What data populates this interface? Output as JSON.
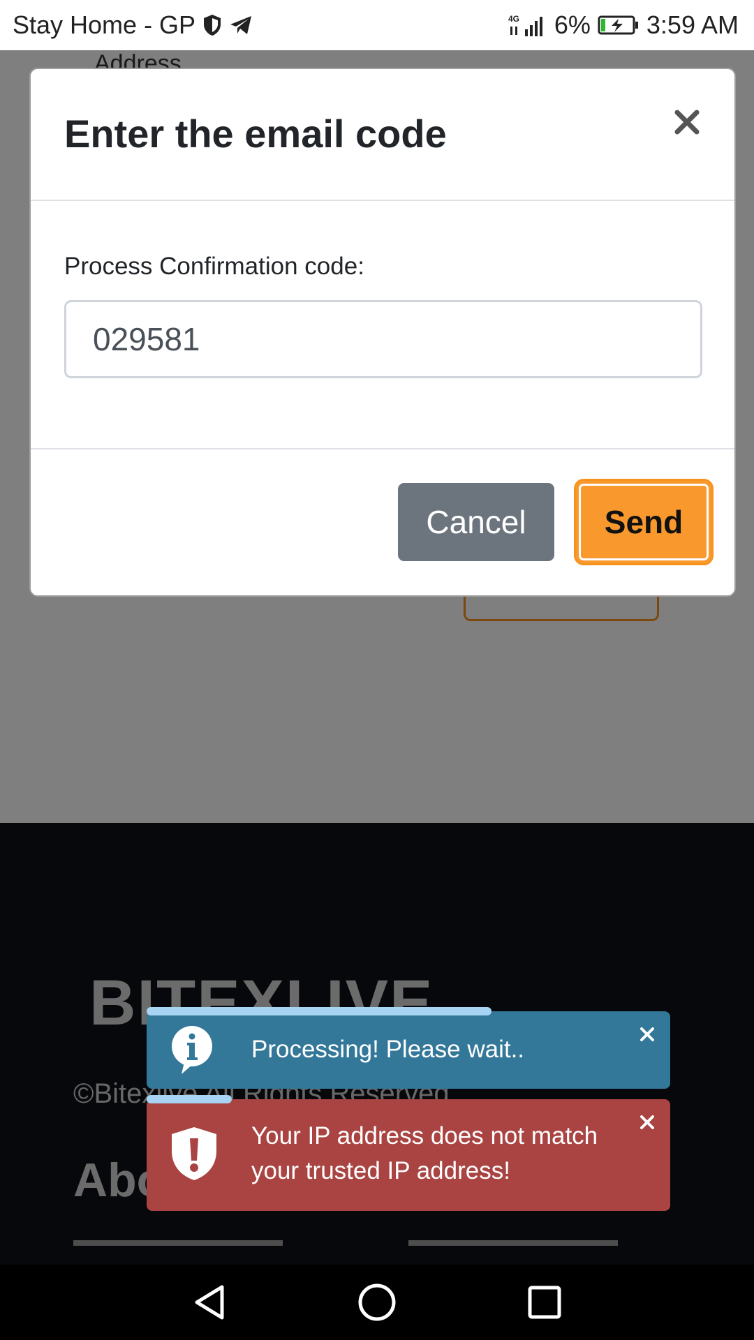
{
  "status_bar": {
    "carrier": "Stay Home - GP",
    "network": "4G",
    "battery": "6%",
    "time": "3:59 AM"
  },
  "background_page": {
    "address_label": "Address",
    "footer": {
      "logo_text": "BITEXLIVE",
      "copyright": "©Bitexlive All Rights Reserved",
      "heading": "Abo"
    }
  },
  "modal": {
    "title": "Enter the email code",
    "field_label": "Process Confirmation code:",
    "code_value": "029581",
    "cancel_label": "Cancel",
    "send_label": "Send"
  },
  "toasts": [
    {
      "type": "info",
      "icon": "info-icon",
      "message": "Processing! Please wait..",
      "color": "#337799"
    },
    {
      "type": "error",
      "icon": "shield-alert-icon",
      "message": "Your IP address does not match your trusted IP address!",
      "color": "#a94442"
    }
  ],
  "colors": {
    "accent": "#f8982d",
    "cancel": "#6c757d"
  }
}
